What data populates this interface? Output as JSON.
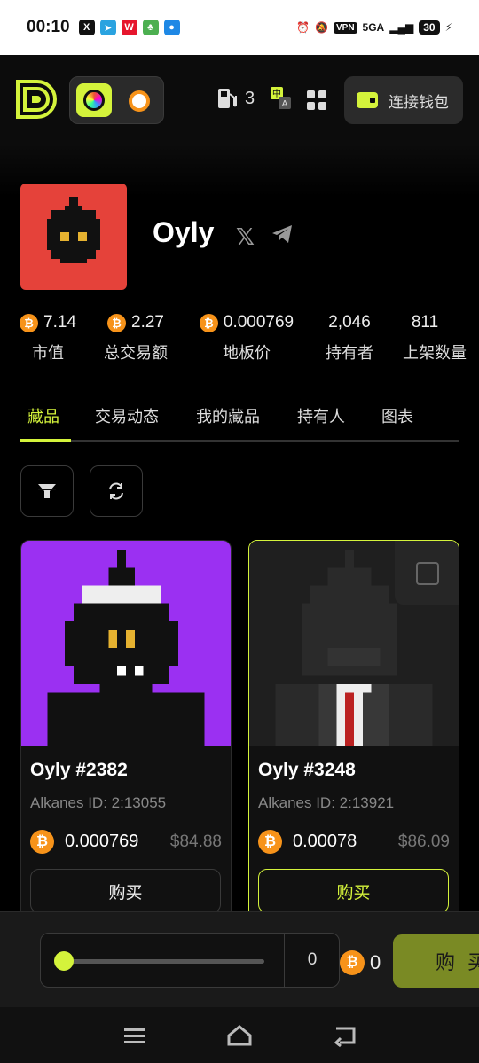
{
  "status_bar": {
    "time": "00:10",
    "network": "5GA",
    "vpn": "VPN",
    "battery": "30"
  },
  "header": {
    "gas_count": "3",
    "connect_wallet": "连接钱包",
    "accent": "#d4f33b"
  },
  "collection": {
    "name": "Oyly",
    "avatar_color": "#e5423a"
  },
  "stats": [
    {
      "value": "7.14",
      "label": "市值",
      "has_btc": true
    },
    {
      "value": "2.27",
      "label": "总交易额",
      "has_btc": true
    },
    {
      "value": "0.000769",
      "label": "地板价",
      "has_btc": true
    },
    {
      "value": "2,046",
      "label": "持有者",
      "has_btc": false
    },
    {
      "value": "811",
      "label": "上架数量",
      "has_btc": false
    }
  ],
  "tabs": [
    "藏品",
    "交易动态",
    "我的藏品",
    "持有人",
    "图表"
  ],
  "items": [
    {
      "title": "Oyly #2382",
      "alkanes_id": "Alkanes ID: 2:13055",
      "price": "0.000769",
      "usd": "$84.88",
      "buy": "购买",
      "bg": "#9b30f2"
    },
    {
      "title": "Oyly #3248",
      "alkanes_id": "Alkanes ID: 2:13921",
      "price": "0.00078",
      "usd": "$86.09",
      "buy": "购买",
      "bg": "#1f1f1f"
    }
  ],
  "bottom": {
    "slider_value": "0",
    "total": "0",
    "buy_label": "购买"
  }
}
